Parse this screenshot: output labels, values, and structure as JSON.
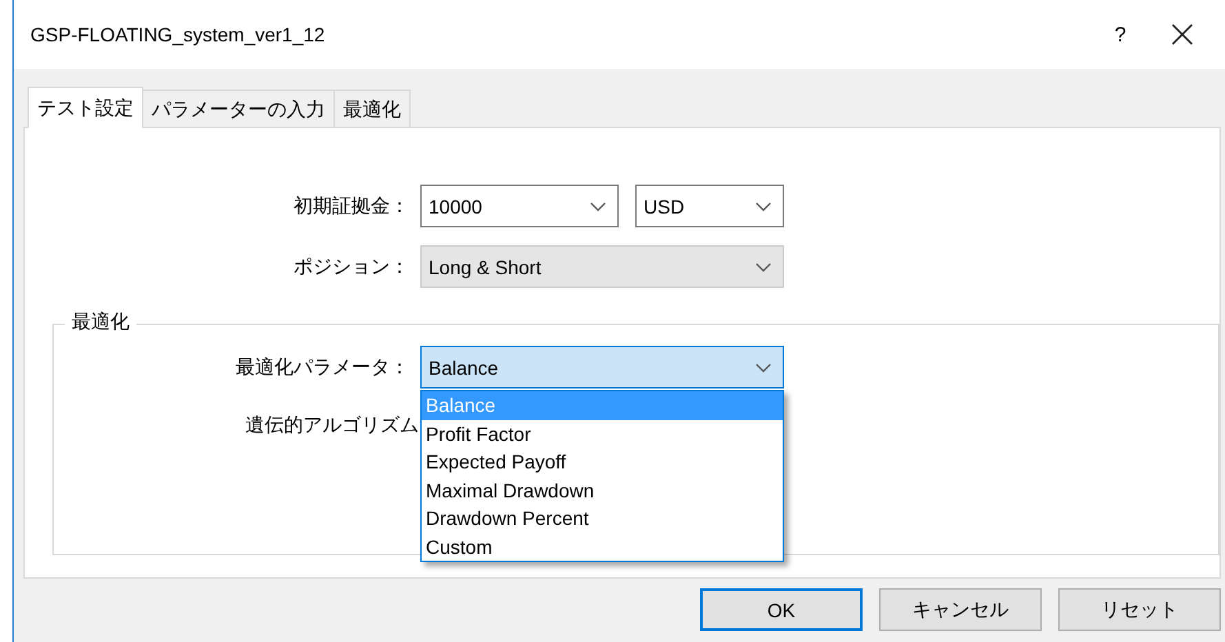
{
  "window": {
    "title": "GSP-FLOATING_system_ver1_12",
    "help": "?"
  },
  "tabs": [
    {
      "label": "テスト設定",
      "selected": true
    },
    {
      "label": "パラメーターの入力",
      "selected": false
    },
    {
      "label": "最適化",
      "selected": false
    }
  ],
  "settings": {
    "initial_deposit": {
      "label": "初期証拠金：",
      "value": "10000",
      "currency": "USD"
    },
    "position": {
      "label": "ポジション：",
      "value": "Long & Short",
      "disabled": true
    }
  },
  "optimization": {
    "title": "最適化",
    "parameter": {
      "label": "最適化パラメータ：",
      "value": "Balance",
      "expanded": true,
      "options": [
        {
          "label": "Balance",
          "selected": true
        },
        {
          "label": "Profit Factor",
          "selected": false
        },
        {
          "label": "Expected Payoff",
          "selected": false
        },
        {
          "label": "Maximal Drawdown",
          "selected": false
        },
        {
          "label": "Drawdown Percent",
          "selected": false
        },
        {
          "label": "Custom",
          "selected": false
        }
      ]
    },
    "genetic_label": "遺伝的アルゴリズム"
  },
  "buttons": [
    {
      "label": "OK",
      "focused": true
    },
    {
      "label": "キャンセル",
      "focused": false
    },
    {
      "label": "リセット",
      "focused": false
    }
  ]
}
